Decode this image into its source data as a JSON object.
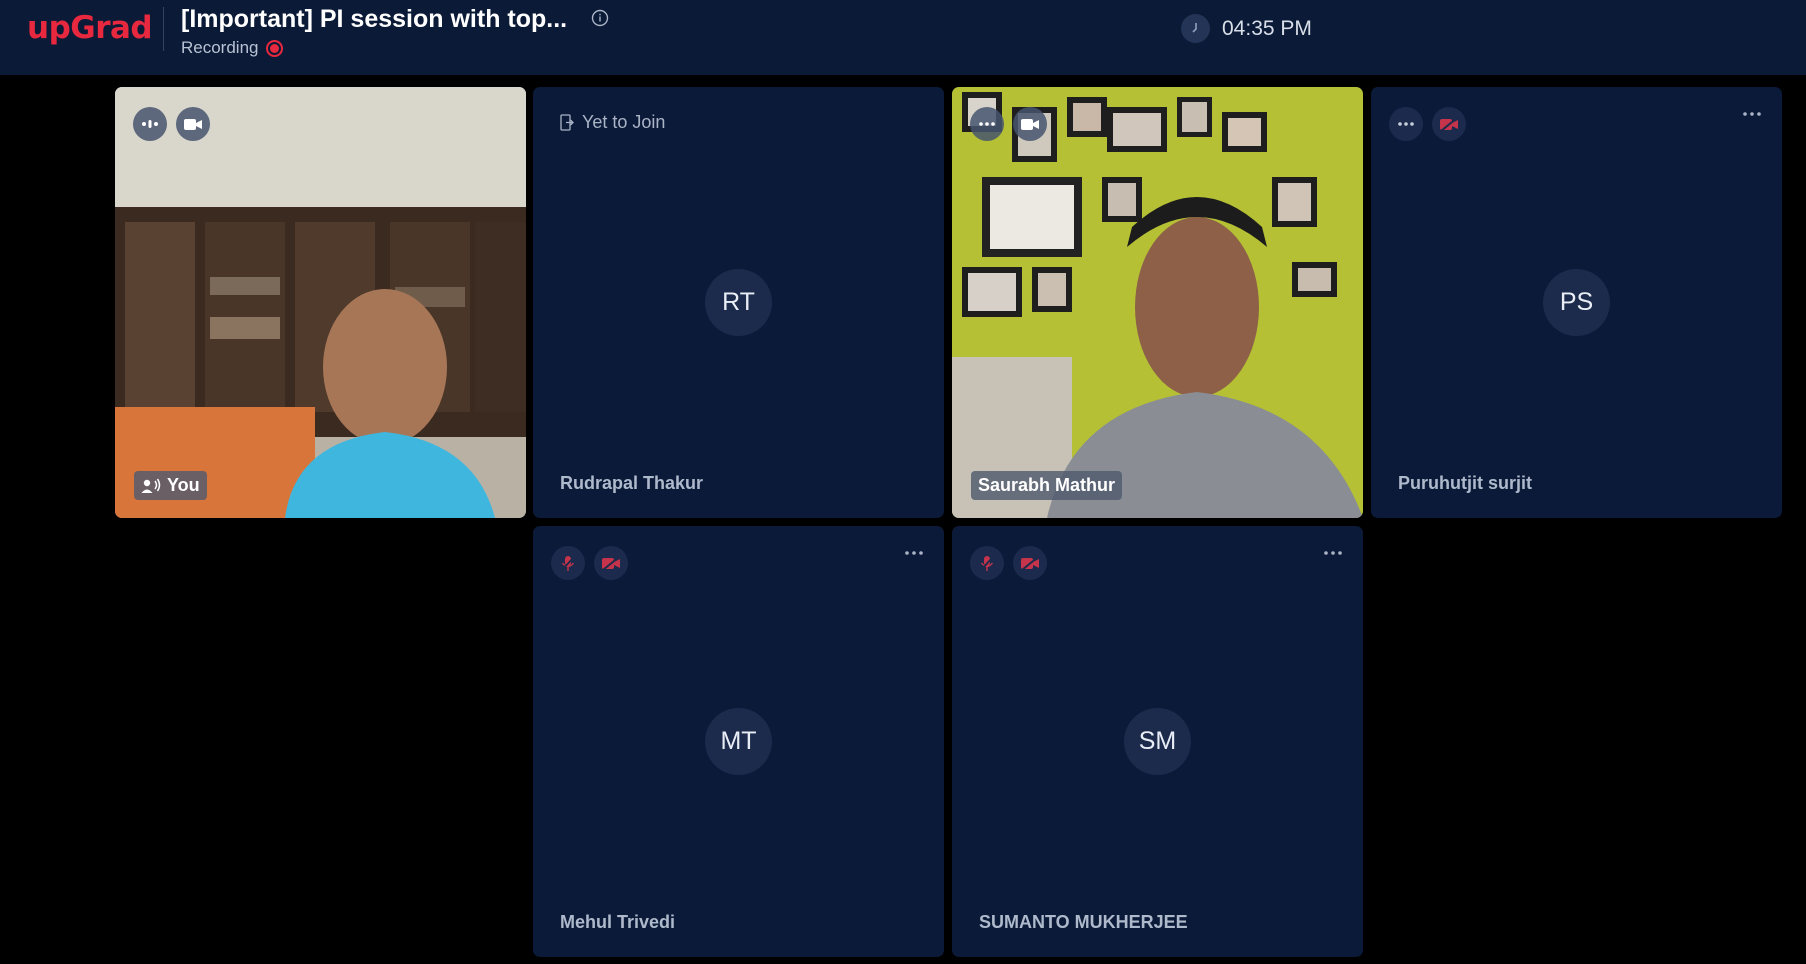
{
  "header": {
    "logo": "upGrad",
    "title": "[Important] PI session with top...",
    "recording_label": "Recording",
    "time": "04:35 PM"
  },
  "participants": {
    "you": {
      "label": "You"
    },
    "rt": {
      "initials": "RT",
      "name": "Rudrapal Thakur",
      "status": "Yet to Join"
    },
    "saurabh": {
      "name": "Saurabh Mathur"
    },
    "ps": {
      "initials": "PS",
      "name": "Puruhutjit surjit"
    },
    "mt": {
      "initials": "MT",
      "name": "Mehul Trivedi"
    },
    "sm": {
      "initials": "SM",
      "name": "SUMANTO MUKHERJEE"
    }
  },
  "colors": {
    "brand": "#e8283e",
    "tile": "#0b1a38",
    "topbar": "#0b1a36"
  }
}
